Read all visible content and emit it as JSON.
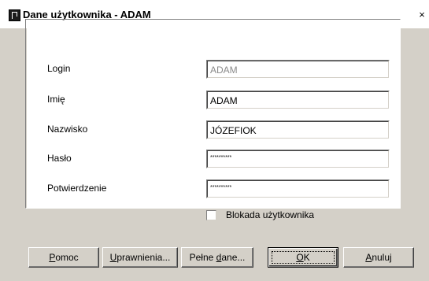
{
  "window": {
    "title": "Dane użytkownika - ADAM",
    "close_label": "×"
  },
  "form": {
    "login": {
      "label": "Login",
      "value": "ADAM",
      "disabled": true
    },
    "imie": {
      "label": "Imię",
      "value": "ADAM"
    },
    "nazwisko": {
      "label": "Nazwisko",
      "value": "JÓZEFIOK"
    },
    "haslo": {
      "label": "Hasło",
      "value": "**********"
    },
    "potwierdzenie": {
      "label": "Potwierdzenie",
      "value": "**********"
    },
    "blokada": {
      "label": "Blokada użytkownika",
      "checked": false
    }
  },
  "buttons": {
    "pomoc": {
      "first": "P",
      "rest": "omoc"
    },
    "uprawnienia": {
      "first": "U",
      "rest": "prawnienia..."
    },
    "pelne_dane": {
      "prefix": "Pełne ",
      "first": "d",
      "rest": "ane..."
    },
    "ok": {
      "first": "O",
      "rest": "K"
    },
    "anuluj": {
      "first": "A",
      "rest": "nuluj"
    }
  },
  "colors": {
    "dialog_bg": "#d4d0c8",
    "panel_bg": "#ffffff",
    "disabled_text": "#8a8a8a"
  },
  "icons": {
    "app": "app-p-icon",
    "close": "close-icon"
  }
}
